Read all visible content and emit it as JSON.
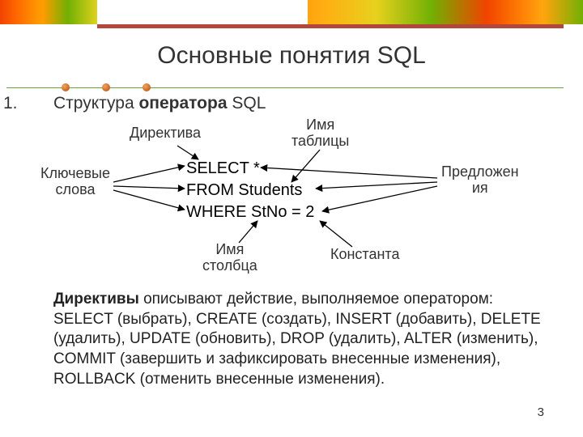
{
  "slide": {
    "title": "Основные понятия SQL",
    "list_number": "1.",
    "subtitle_prefix": "Структура ",
    "subtitle_bold": "оператора",
    "subtitle_suffix": " SQL",
    "page_number": "3"
  },
  "diagram": {
    "labels": {
      "directive": "Директива",
      "table_name": "Имя\nтаблицы",
      "keywords": "Ключевые\nслова",
      "clauses": "Предложен\nия",
      "column_name": "Имя\nстолбца",
      "constant": "Константа"
    },
    "code": {
      "line1": "SELECT *",
      "line2": "FROM Students",
      "line3": "WHERE StNo = 2"
    }
  },
  "body": {
    "bold_lead": "Директивы",
    "rest": " описывают действие, выполняемое оператором: SELECT (выбрать), CREATE (создать), INSERT (добавить), DELETE (удалить), UPDATE (обновить), DROP (удалить), ALTER (изменить), COMMIT (завершить и зафиксировать внесенные изменения), ROLLBACK (отменить внесенные изменения)."
  }
}
